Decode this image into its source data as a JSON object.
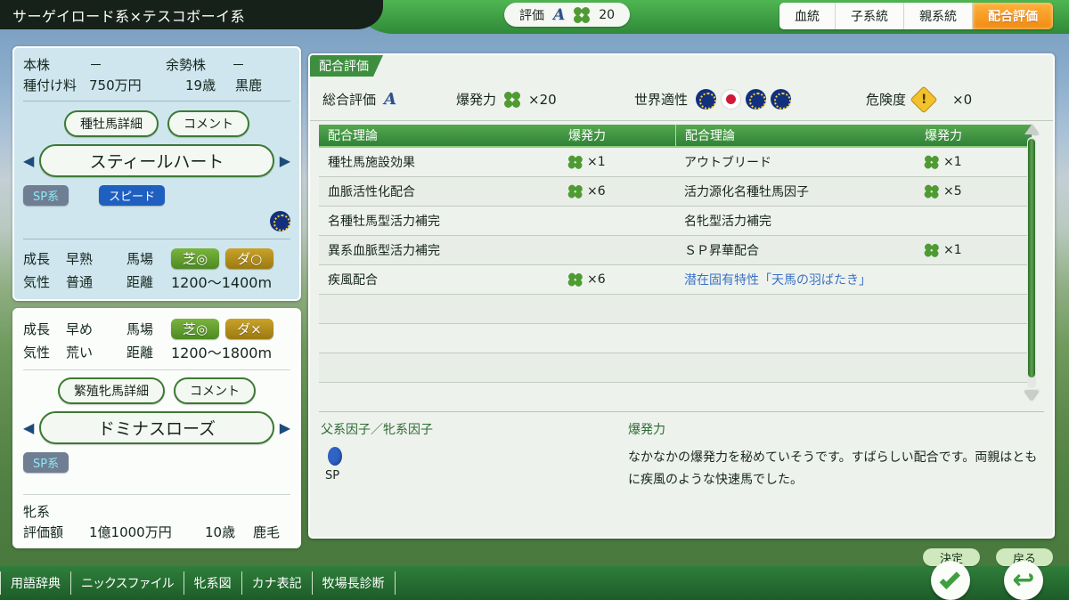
{
  "header": {
    "title": "サーゲイロード系×テスコボーイ系",
    "eval_label": "評価",
    "eval_grade": "A",
    "eval_count": "20",
    "tabs": [
      {
        "label": "血統",
        "active": false
      },
      {
        "label": "子系統",
        "active": false
      },
      {
        "label": "親系統",
        "active": false
      },
      {
        "label": "配合評価",
        "active": true
      }
    ]
  },
  "sire_panel": {
    "stock_label": "本株",
    "stock_value": "－",
    "surplus_label": "余勢株",
    "surplus_value": "－",
    "fee_label": "種付け料",
    "fee_value": "750万円",
    "age": "19歳",
    "coat": "黒鹿",
    "detail_button": "種牡馬詳細",
    "comment_button": "コメント",
    "name": "スティールハート",
    "badge_line": "SP系",
    "badge_type": "スピード",
    "flag": "eu-flag-icon",
    "growth_label": "成長",
    "growth_value": "早熟",
    "temper_label": "気性",
    "temper_value": "普通",
    "surface_label": "馬場",
    "turf": "芝◎",
    "dirt": "ダ○",
    "distance_label": "距離",
    "distance_value": "1200〜1400m"
  },
  "mare_panel": {
    "growth_label": "成長",
    "growth_value": "早め",
    "temper_label": "気性",
    "temper_value": "荒い",
    "surface_label": "馬場",
    "turf": "芝◎",
    "dirt": "ダ×",
    "distance_label": "距離",
    "distance_value": "1200〜1800m",
    "detail_button": "繁殖牝馬詳細",
    "comment_button": "コメント",
    "name": "ドミナスローズ",
    "badge_line": "SP系",
    "family_label": "牝系",
    "value_label": "評価額",
    "value_amount": "1億1000万円",
    "age": "10歳",
    "coat": "鹿毛"
  },
  "main": {
    "panel_tag": "配合評価",
    "summary": {
      "total_label": "総合評価",
      "total_grade": "A",
      "power_label": "爆発力",
      "power_value": "×20",
      "world_label": "世界適性",
      "world_flags": [
        "eu",
        "jp",
        "eu",
        "eu"
      ],
      "risk_label": "危険度",
      "risk_value": "×0"
    },
    "table": {
      "headers": [
        "配合理論",
        "爆発力",
        "配合理論",
        "爆発力"
      ],
      "rows": [
        {
          "left": "種牡馬施設効果",
          "left_power": "×1",
          "right": "アウトブリード",
          "right_power": "×1",
          "right_blue": false
        },
        {
          "left": "血脈活性化配合",
          "left_power": "×6",
          "right": "活力源化名種牡馬因子",
          "right_power": "×5",
          "right_blue": false
        },
        {
          "left": "名種牡馬型活力補完",
          "left_power": "",
          "right": "名牝型活力補完",
          "right_power": "",
          "right_blue": false
        },
        {
          "left": "異系血脈型活力補完",
          "left_power": "",
          "right": "ＳＰ昇華配合",
          "right_power": "×1",
          "right_blue": false
        },
        {
          "left": "疾風配合",
          "left_power": "×6",
          "right": "潜在固有特性「天馬の羽ばたき」",
          "right_power": "",
          "right_blue": true
        },
        {
          "left": "",
          "left_power": "",
          "right": "",
          "right_power": "",
          "right_blue": false
        },
        {
          "left": "",
          "left_power": "",
          "right": "",
          "right_power": "",
          "right_blue": false
        },
        {
          "left": "",
          "left_power": "",
          "right": "",
          "right_power": "",
          "right_blue": false
        },
        {
          "left": "",
          "left_power": "",
          "right": "",
          "right_power": "",
          "right_blue": false
        }
      ]
    },
    "description": {
      "factor_title": "父系因子／牝系因子",
      "factor_label": "SP",
      "power_title": "爆発力",
      "power_text": "なかなかの爆発力を秘めていそうです。すばらしい配合です。両親はともに疾風のような快速馬でした。"
    }
  },
  "bottom": {
    "menu": [
      "用語辞典",
      "ニックスファイル",
      "牝系図",
      "カナ表記",
      "牧場長診断"
    ],
    "confirm_label": "決定",
    "back_label": "戻る"
  },
  "colors": {
    "accent_green": "#3d8f3f",
    "tab_active": "#f08a12",
    "clover": "#4f9b33",
    "blue_text": "#3b72c4"
  }
}
